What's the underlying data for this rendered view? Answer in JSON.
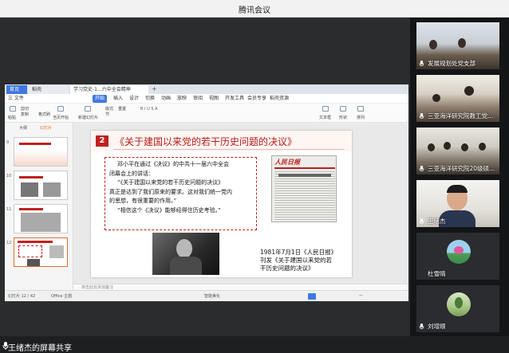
{
  "window": {
    "title": "腾讯会议"
  },
  "wps": {
    "tabs": [
      {
        "label": "首页"
      },
      {
        "label": "稻壳"
      },
      {
        "label": "学习党史-1...六中全会精神"
      }
    ],
    "new_tab": "+",
    "menus": [
      "三 文件",
      "开始",
      "插入",
      "设计",
      "切换",
      "动画",
      "放映",
      "审阅",
      "视图",
      "开发工具",
      "会员专享",
      "稻壳资源"
    ],
    "ribbon_labels": [
      "粘贴",
      "剪切",
      "复制",
      "格式刷",
      "当页开始",
      "新建幻灯片",
      "版式",
      "节",
      "重置",
      "文本框",
      "形状",
      "排列"
    ],
    "panel_tabs": [
      "大纲",
      "幻灯片"
    ],
    "slide_numbers": [
      "9",
      "10",
      "11",
      "12"
    ],
    "slide": {
      "number": "2",
      "title": "《关于建国以来党的若干历史问题的决议》",
      "quote_lines": [
        "邓小平在通过《决议》的中共十一届六中全会",
        "闭幕会上的讲话：",
        "“《关于建国以来党的若干历史问题的决议》",
        "真正是达到了我们原来的要求。这对我们统一党内",
        "的思想，有很重要的作用。”",
        "“相信这个《决议》能够经得住历史考验。”"
      ],
      "newspaper_title": "人民日报",
      "caption_lines": [
        "1981年7月1日《人民日报》",
        "刊发《关于建国以来党的若",
        "干历史问题的决议》"
      ]
    },
    "notes_placeholder": "单击此处添加备注",
    "status": {
      "slide_info": "幻灯片 12 / 42",
      "theme": "Office 主题",
      "view": "智能美化",
      "zoom": "—"
    }
  },
  "share": {
    "label": "王绪杰的屏幕共享"
  },
  "participants": [
    {
      "name": "发展规划处党支部"
    },
    {
      "name": "三亚海洋研究院教工党..."
    },
    {
      "name": "三亚海洋研究院20级硕..."
    },
    {
      "name": "王绪杰"
    },
    {
      "name": "杜雪晴"
    },
    {
      "name": "刘增顺"
    }
  ],
  "colors": {
    "accent": "#3f79e0",
    "slide_red": "#c0201d",
    "wps_tab": "#e56a2d"
  }
}
